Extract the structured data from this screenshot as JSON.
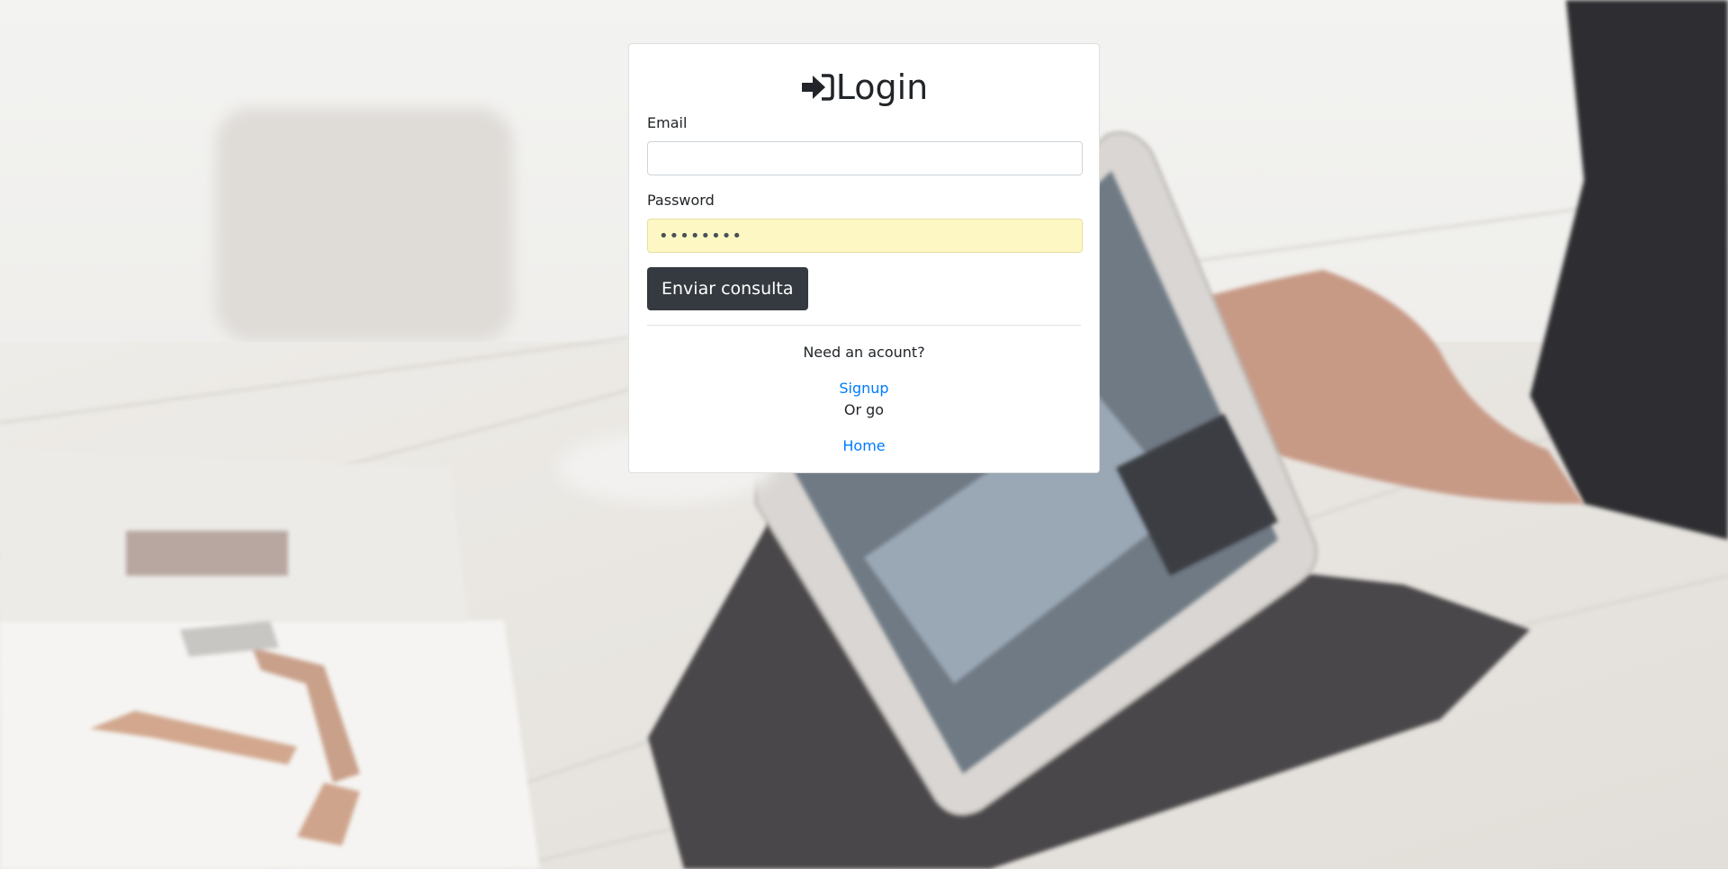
{
  "login_card": {
    "title": "Login",
    "title_icon": "sign-in-icon",
    "email": {
      "label": "Email",
      "value": "",
      "placeholder": ""
    },
    "password": {
      "label": "Password",
      "masked_value": "••••••••"
    },
    "submit_label": "Enviar consulta",
    "need_account_text": "Need an acount?",
    "signup_link": "Signup",
    "or_go_text": "Or go",
    "home_link": "Home"
  },
  "colors": {
    "button_bg": "#343a40",
    "link": "#007bff",
    "autofill_bg": "#fdf8c3"
  },
  "background": {
    "image_subject": "hand-tapping-tablet-on-table"
  }
}
